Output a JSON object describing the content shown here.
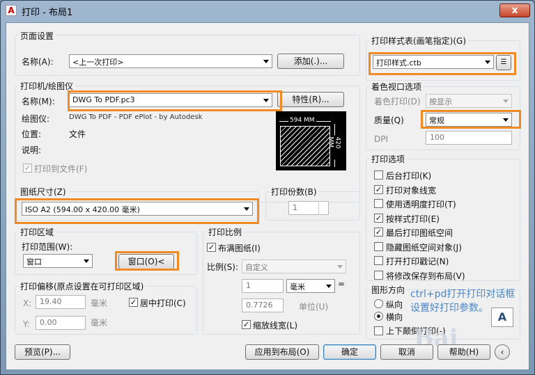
{
  "window": {
    "title": "打印 - 布局1",
    "close": "x"
  },
  "page_setup": {
    "group": "页面设置",
    "name_label": "名称(A):",
    "name_value": "<上一次打印>",
    "add_button": "添加(.)..."
  },
  "printer": {
    "group": "打印机/绘图仪",
    "name_label": "名称(M):",
    "name_value": "DWG To PDF.pc3",
    "properties_button": "特性(R)...",
    "plotter_label": "绘图仪:",
    "plotter_value": "DWG To PDF - PDF ePlot - by Autodesk",
    "location_label": "位置:",
    "location_value": "文件",
    "description_label": "说明:",
    "print_to_file": "打印到文件(F)"
  },
  "preview": {
    "width": "594 MM",
    "height": "420 MM"
  },
  "paper_size": {
    "group": "图纸尺寸(Z)",
    "value": "ISO A2 (594.00 x 420.00 毫米)"
  },
  "copies": {
    "label": "打印份数(B)",
    "value": "1"
  },
  "plot_area": {
    "group": "打印区域",
    "range_label": "打印范围(W):",
    "range_value": "窗口",
    "window_button": "窗口(O)<"
  },
  "offset": {
    "group": "打印偏移(原点设置在可打印区域)",
    "x_label": "X:",
    "x_value": "19.40",
    "x_unit": "毫米",
    "y_label": "Y:",
    "y_value": "0.00",
    "y_unit": "毫米",
    "center": "居中打印(C)"
  },
  "scale": {
    "group": "打印比例",
    "fit": "布满图纸(I)",
    "scale_label": "比例(S):",
    "scale_value": "自定义",
    "val1": "1",
    "unit": "毫米",
    "eq": "=",
    "val2": "0.7726",
    "unit2": "单位(U)",
    "lineweights": "缩放线宽(L)"
  },
  "style_table": {
    "group": "打印样式表(画笔指定)(G)",
    "value": "打印样式.ctb"
  },
  "shaded": {
    "group": "着色视口选项",
    "shade_label": "着色打印(D)",
    "shade_value": "按显示",
    "quality_label": "质量(Q)",
    "quality_value": "常规",
    "dpi_label": "DPI",
    "dpi_value": "100"
  },
  "options": {
    "group": "打印选项",
    "items": [
      "后台打印(K)",
      "打印对象线宽",
      "使用透明度打印(T)",
      "按样式打印(E)",
      "最后打印图纸空间",
      "隐藏图纸空间对象(J)",
      "打开打印戳记(N)",
      "将修改保存到布局(V)"
    ],
    "checked": [
      false,
      true,
      false,
      true,
      true,
      false,
      false,
      false
    ]
  },
  "orientation": {
    "group": "图形方向",
    "portrait": "纵向",
    "landscape": "横向",
    "upside": "上下颠倒打印(-)"
  },
  "annotation": {
    "line1": "ctrl+pd打开打印对话框",
    "line2": "设置好打印参数。"
  },
  "buttons": {
    "preview": "预览(P)...",
    "apply": "应用到布局(O)",
    "ok": "确定",
    "cancel": "取消",
    "help": "帮助(H)"
  },
  "watermark": "Bai"
}
